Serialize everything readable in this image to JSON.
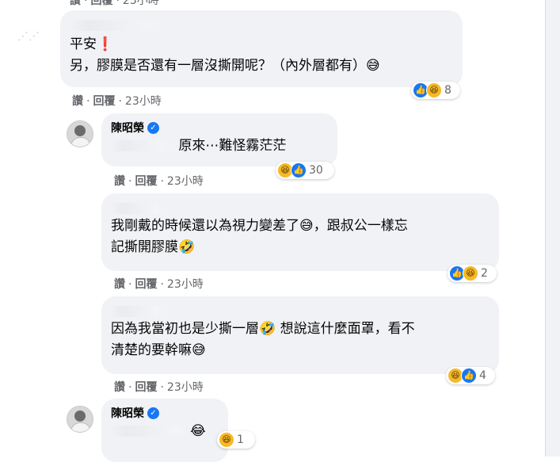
{
  "actions": {
    "like": "讚",
    "reply": "回覆",
    "sep": "·"
  },
  "top_partial": {
    "time": "23小時"
  },
  "comments": [
    {
      "author_hidden": true,
      "lines": [
        "平安❗",
        "另，膠膜是否還有一層沒撕開呢？（內外層都有）😅"
      ],
      "time": "23小時",
      "reaction_count": "8",
      "reaction_icons": [
        "like-icon",
        "haha-icon"
      ]
    },
    {
      "author": "陳昭榮",
      "verified": true,
      "text": "原來⋯難怪霧茫茫",
      "time": "23小時",
      "reaction_count": "30",
      "reaction_icons": [
        "haha-icon",
        "like-icon"
      ]
    },
    {
      "lines": [
        "我剛戴的時候還以為視力變差了😅，跟叔公一樣忘",
        "記撕開膠膜🤣"
      ],
      "time": "23小時",
      "reaction_count": "2",
      "reaction_icons": [
        "like-icon",
        "haha-icon"
      ]
    },
    {
      "lines": [
        "因為我當初也是少撕一層🤣 想說這什麼面罩，看不",
        "清楚的要幹嘛😅"
      ],
      "time": "23小時",
      "reaction_count": "4",
      "reaction_icons": [
        "haha-icon",
        "like-icon"
      ]
    },
    {
      "author": "陳昭榮",
      "verified": true,
      "text": "😂",
      "reaction_count": "1",
      "reaction_icons": [
        "haha-icon"
      ]
    }
  ],
  "colors": {
    "bubble": "#f0f2f5",
    "meta": "#65676b",
    "like": "#1877f2",
    "haha": "#f7b928",
    "exclaim": "#e41e3f"
  }
}
